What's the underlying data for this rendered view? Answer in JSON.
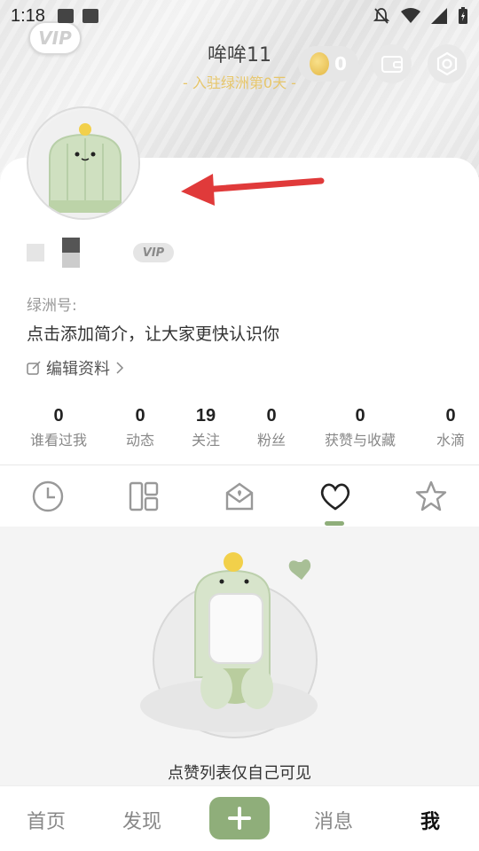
{
  "status_bar": {
    "time": "1:18"
  },
  "profile": {
    "username": "哞哞11",
    "joined_days": "- 入驻绿洲第0天 -",
    "coins": "0",
    "vip_label": "VIP",
    "oasis_id_label": "绿洲号:",
    "bio_placeholder": "点击添加简介，让大家更快认识你",
    "edit_label": "编辑资料"
  },
  "stats": [
    {
      "value": "0",
      "label": "谁看过我"
    },
    {
      "value": "0",
      "label": "动态"
    },
    {
      "value": "19",
      "label": "关注"
    },
    {
      "value": "0",
      "label": "粉丝"
    },
    {
      "value": "0",
      "label": "获赞与收藏"
    },
    {
      "value": "0",
      "label": "水滴"
    }
  ],
  "tabs": [
    {
      "icon": "clock-icon"
    },
    {
      "icon": "grid-icon"
    },
    {
      "icon": "mail-heart-icon"
    },
    {
      "icon": "heart-icon",
      "active": true
    },
    {
      "icon": "star-icon"
    }
  ],
  "empty_state": {
    "message": "点赞列表仅自己可见"
  },
  "bottom_nav": {
    "home": "首页",
    "discover": "发现",
    "messages": "消息",
    "me": "我"
  },
  "colors": {
    "accent": "#8fae7a",
    "gold": "#e7c66a",
    "arrow": "#e03a3a"
  }
}
